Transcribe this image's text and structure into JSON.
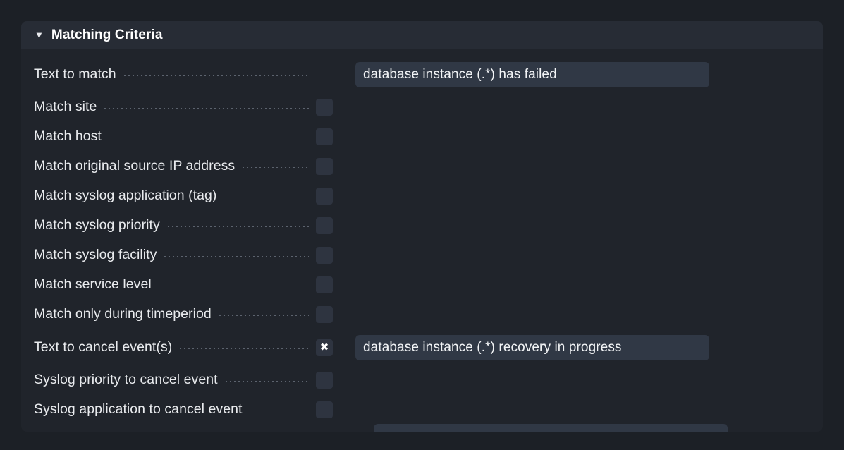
{
  "panel": {
    "title": "Matching Criteria",
    "collapse_icon": "▼",
    "expanded": true
  },
  "icons": {
    "checked_mark": "✖"
  },
  "colors": {
    "page_background": "#1c2026",
    "panel_background": "#20242b",
    "panel_header_background": "#272c35",
    "input_background": "#303845",
    "checkbox_background": "#2e3440",
    "label_text": "#e9ebee",
    "input_text": "#f2f4f6",
    "leader_dots": "#5c636e"
  },
  "rows": [
    {
      "label": "Text to match",
      "control": "text",
      "value": "database instance (.*) has failed",
      "placeholder": ""
    },
    {
      "label": "Match site",
      "control": "checkbox",
      "checked": false
    },
    {
      "label": "Match host",
      "control": "checkbox",
      "checked": false
    },
    {
      "label": "Match original source IP address",
      "control": "checkbox",
      "checked": false
    },
    {
      "label": "Match syslog application (tag)",
      "control": "checkbox",
      "checked": false
    },
    {
      "label": "Match syslog priority",
      "control": "checkbox",
      "checked": false
    },
    {
      "label": "Match syslog facility",
      "control": "checkbox",
      "checked": false
    },
    {
      "label": "Match service level",
      "control": "checkbox",
      "checked": false
    },
    {
      "label": "Match only during timeperiod",
      "control": "checkbox",
      "checked": false
    },
    {
      "label": "Text to cancel event(s)",
      "control": "checkbox-with-text",
      "checked": true,
      "value": "database instance (.*) recovery in progress",
      "placeholder": ""
    },
    {
      "label": "Syslog priority to cancel event",
      "control": "checkbox",
      "checked": false
    },
    {
      "label": "Syslog application to cancel event",
      "control": "checkbox",
      "checked": false
    }
  ]
}
